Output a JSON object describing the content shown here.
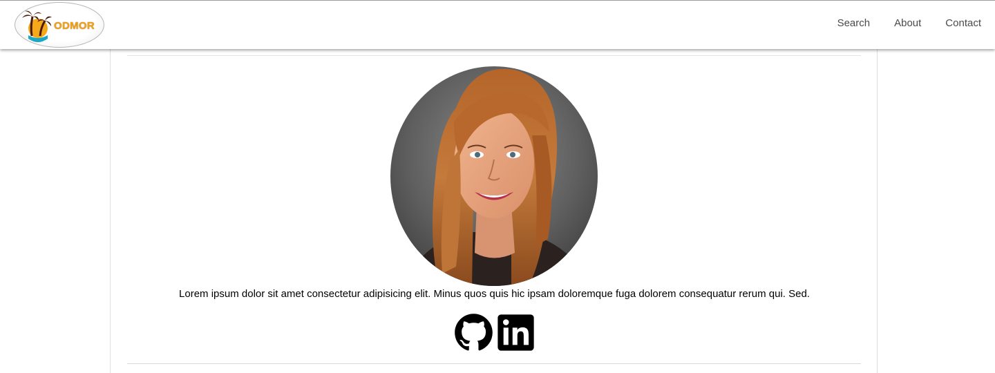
{
  "header": {
    "logo_text": "ODMOR",
    "nav": [
      {
        "label": "Search"
      },
      {
        "label": "About"
      },
      {
        "label": "Contact"
      }
    ]
  },
  "profile": {
    "bio": "Lorem ipsum dolor sit amet consectetur adipisicing elit. Minus quos quis hic ipsam doloremque fuga dolorem consequatur rerum qui. Sed.",
    "socials": [
      {
        "icon": "github-icon"
      },
      {
        "icon": "linkedin-icon"
      }
    ]
  },
  "colors": {
    "logo_accent": "#f0a314",
    "nav_text": "#4a4a4a"
  }
}
